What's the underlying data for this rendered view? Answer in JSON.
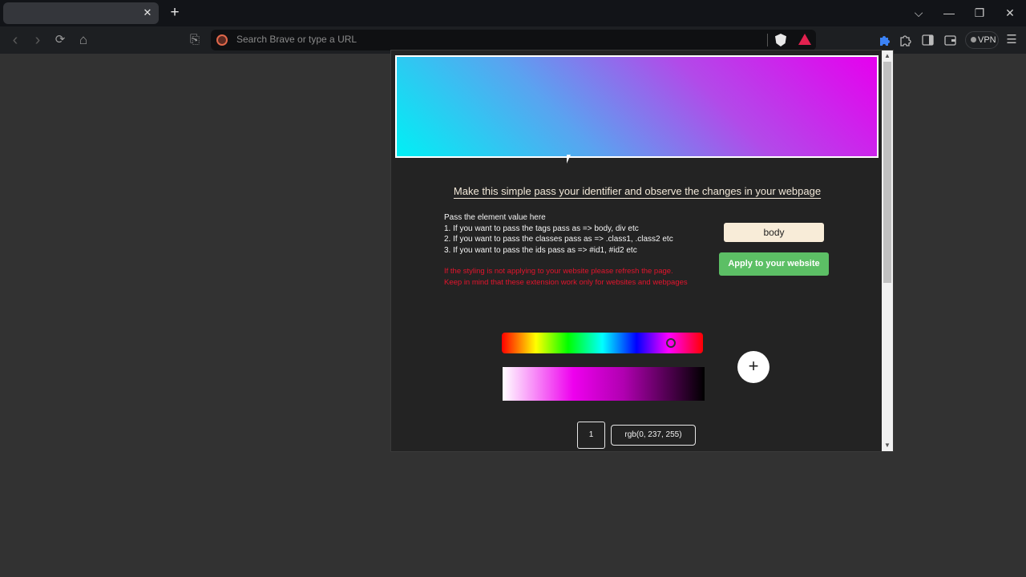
{
  "browser": {
    "tab": {
      "title": "",
      "close_icon": "close-icon"
    },
    "new_tab_label": "+",
    "window_controls": {
      "dropdown": "⌵",
      "minimize": "—",
      "restore": "❐",
      "close": "✕"
    },
    "toolbar": {
      "back": "‹",
      "forward": "›",
      "reload": "⟳",
      "home": "⌂",
      "bookmark": "⎘",
      "omnibox_placeholder": "Search Brave or type a URL",
      "vpn_label": "VPN",
      "extensions_icon": "puzzle-icon",
      "sidebar_icon": "sidebar-icon",
      "wallet_icon": "wallet-icon",
      "menu_icon": "☰"
    }
  },
  "extension": {
    "preview_gradient": {
      "from": "#00f0f4",
      "to": "#e600ee"
    },
    "heading": "Make this simple pass your identifier and observe the changes in your webpage",
    "instructions": [
      "Pass the element value here",
      "1. If you want to pass the tags pass as => body, div etc",
      "2. If you want to pass the classes pass as => .class1, .class2 etc",
      "3. If you want to pass the ids pass as => #id1, #id2 etc"
    ],
    "warning": [
      "If the styling is not applying to your website please refresh the page.",
      "Keep in mind that these extension work only for websites and webpages"
    ],
    "identifier_value": "body",
    "apply_label": "Apply to your website",
    "hue_level": 0.84,
    "add_label": "+",
    "color_count": "1",
    "rgb_value": "rgb(0, 237, 255)",
    "colors": {
      "accent_green": "#5cbf65",
      "warning_red": "#e3142c",
      "input_bg": "#f8ecd8"
    }
  }
}
